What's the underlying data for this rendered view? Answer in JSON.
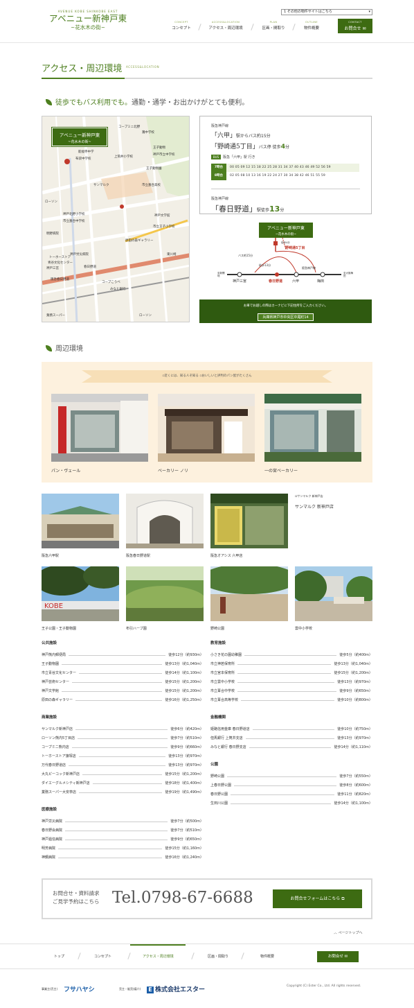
{
  "header": {
    "logo_en": "AVENUE KOBE SHINKOBE EAST",
    "logo_ja": "アベニュー新神戸東",
    "logo_sub": "~花水木の街~",
    "other_select": "1 その他の物件サイトはこちら",
    "nav": [
      {
        "en": "CONCEPT",
        "ja": "コンセプト"
      },
      {
        "en": "ACCESS&LOCATION",
        "ja": "アクセス・周辺環境"
      },
      {
        "en": "PLAN",
        "ja": "区画・間取り"
      },
      {
        "en": "OUTLINE",
        "ja": "物件概要"
      }
    ],
    "contact_en": "CONTACT",
    "contact_ja": "お問合せ"
  },
  "page": {
    "title_ja": "アクセス・周辺環境",
    "title_en": "ACCESS&LOCATION",
    "lead_green": "徒歩でもバス利用でも。",
    "lead_rest": "通勤・通学・お出かけがとても便利。"
  },
  "map": {
    "label": "アベニュー新神戸東",
    "label_sub": "~花水木の街~",
    "places": [
      "灘中学校",
      "能福寺中学",
      "布袋中学校",
      "上筒井小学校",
      "コープミニ北野",
      "王子動物",
      "神戸市立中学校",
      "王子動物園",
      "サンマルク",
      "市立葺合高校",
      "ローソン",
      "神戸北野小学校",
      "市立葺合中学校",
      "神戸三宮",
      "春日野道",
      "トーホーストア",
      "青谷文化センター",
      "みなと銀行",
      "コープこうべ",
      "東川崎",
      "原田の森ギャラリー",
      "神戸文学館",
      "市立王子小学校",
      "明野病院",
      "阪急春日野道",
      "ローソン",
      "業務スーパー",
      "神戸労災病院"
    ]
  },
  "bus": {
    "line1": "阪急神戸線",
    "station": "六甲",
    "station_suffix": "駅からバス約15分",
    "stop": "野崎通5丁目",
    "stop_suffix": "バス停 徒歩",
    "stop_min": "4",
    "stop_min_unit": "分",
    "bus_label": "阪急「六甲」駅 行き",
    "rows": [
      {
        "h": "7時台",
        "m": "00 05 09 12 15 18 22 25 28 31 34 37 40 43 46 49 52 56 59"
      },
      {
        "h": "8時台",
        "m": "02 05 08 10 13 16 19 22 24 27 30 34 38 42 46 51 55 59"
      }
    ],
    "line2": "阪急神戸線",
    "walk_station": "春日野道",
    "walk_prefix": "駅徒歩",
    "walk_min": "13",
    "walk_unit": "分"
  },
  "route": {
    "label": "アベニュー新神戸東",
    "label_sub": "~花水木の街~",
    "stop": "野崎通5丁目",
    "walk_bus": "徒歩4分",
    "bus_time": "バス約15分",
    "walk13": "徒歩13分",
    "line": "阪急神戸線",
    "stations": [
      "神戸三宮",
      "春日野道",
      "六甲",
      "梅田"
    ],
    "ends": [
      "至新開地",
      "至大阪梅田"
    ]
  },
  "car": {
    "text": "お車でお越しの際はカーナビに下記住所をご入力ください。",
    "address": "兵庫県神戸市中央区中尾町14"
  },
  "env": {
    "title": "周辺環境",
    "ribbon_a": "近くには、知る人ぞ知る",
    "ribbon_b": "おいしいと評判のパン屋がたくさん",
    "bakeries": [
      "パン・ヴェール",
      "ベーカリー ノリ",
      "一の宮ベーカリー"
    ],
    "photos": [
      "阪急六甲駅",
      "阪急春日野道駅",
      "阪急オアシス 六甲店",
      "サンマルク 新神戸店",
      "王子公園・王子動物園",
      "布引ハーブ園",
      "野崎公園",
      "雲中小学校"
    ],
    "sunmarc_alt": "サンマルク 新神戸店"
  },
  "facilities": {
    "left": [
      {
        "cat": "公共施設",
        "items": [
          {
            "n": "神戸熊内郵便局",
            "d": "徒歩12分（約930m）"
          },
          {
            "n": "王子動物園",
            "d": "徒歩13分（約1,040m）"
          },
          {
            "n": "市立青谷文化センター",
            "d": "徒歩14分（約1,100m）"
          },
          {
            "n": "神戸芸術センター",
            "d": "徒歩15分（約1,200m）"
          },
          {
            "n": "神戸文学館",
            "d": "徒歩15分（約1,200m）"
          },
          {
            "n": "原田の森ギャラリー",
            "d": "徒歩16分（約1,250m）"
          }
        ]
      },
      {
        "cat": "商業施設",
        "items": [
          {
            "n": "サンマルク新神戸店",
            "d": "徒歩6分（約420m）"
          },
          {
            "n": "ローソン熊内5丁目店",
            "d": "徒歩7分（約510m）"
          },
          {
            "n": "コープミニ熊内店",
            "d": "徒歩9分（約660m）"
          },
          {
            "n": "トーホーストア旗塚店",
            "d": "徒歩13分（約970m）"
          },
          {
            "n": "万代春日野道店",
            "d": "徒歩13分（約970m）"
          },
          {
            "n": "大丸ピーコック新神戸店",
            "d": "徒歩15分（約1,200m）"
          },
          {
            "n": "ダイエーグルメシティ新神戸店",
            "d": "徒歩18分（約1,400m）"
          },
          {
            "n": "業務スーパー大安亭店",
            "d": "徒歩19分（約1,490m）"
          }
        ]
      },
      {
        "cat": "医療施設",
        "items": [
          {
            "n": "神戸労災病院",
            "d": "徒歩7分（約500m）"
          },
          {
            "n": "春日野会病院",
            "d": "徒歩7分（約510m）"
          },
          {
            "n": "神戸逓信病院",
            "d": "徒歩9分（約650m）"
          },
          {
            "n": "明芳病院",
            "d": "徒歩15分（約1,160m）"
          },
          {
            "n": "神鋼病院",
            "d": "徒歩16分（約1,240m）"
          }
        ]
      }
    ],
    "right": [
      {
        "cat": "教育施設",
        "items": [
          {
            "n": "小さき花の園幼稚園",
            "d": "徒歩5分（約400m）"
          },
          {
            "n": "市立神若保育所",
            "d": "徒歩13分（約1,040m）"
          },
          {
            "n": "市立宮本保育所",
            "d": "徒歩15分（約1,200m）"
          },
          {
            "n": "市立雲中小学校",
            "d": "徒歩13分（約970m）"
          },
          {
            "n": "市立葺合中学校",
            "d": "徒歩9分（約650m）"
          },
          {
            "n": "市立葺合高等学校",
            "d": "徒歩10分（約800m）"
          }
        ]
      },
      {
        "cat": "金融機関",
        "items": [
          {
            "n": "姫路信用金庫 春日野道店",
            "d": "徒歩10分（約750m）"
          },
          {
            "n": "但馬銀行 上筒井支店",
            "d": "徒歩13分（約970m）"
          },
          {
            "n": "みなと銀行 春日野支店",
            "d": "徒歩14分（約1,110m）"
          }
        ]
      },
      {
        "cat": "公園",
        "items": [
          {
            "n": "野崎公園",
            "d": "徒歩7分（約550m）"
          },
          {
            "n": "上春日野公園",
            "d": "徒歩8分（約600m）"
          },
          {
            "n": "春日野公園",
            "d": "徒歩11分（約820m）"
          },
          {
            "n": "生田川公園",
            "d": "徒歩14分（約1,100m）"
          }
        ]
      }
    ]
  },
  "contact": {
    "line1": "お問合せ・資料請求",
    "line2": "ご見学予約はこちら",
    "tel": "Tel.0798-67-6688",
    "button": "お問合せフォームはこちら"
  },
  "pagetop": "ページトップへ",
  "footer_nav": [
    "トップ",
    "コンセプト",
    "アクセス・周辺環境",
    "区画・間取り",
    "物件概要"
  ],
  "footer_contact": "お問合せ",
  "footer": {
    "label1": "事業主(売主)",
    "company1": "フサハヤシ",
    "label2": "売主・販売(媒介)",
    "company2": "株式会社エスター",
    "copyright": "Copyright (C) Ester Co., Ltd. All rights reserved."
  },
  "colors": {
    "accent": "#4d7f1f",
    "dark": "#3d6b12",
    "bakery_bg": "#fdf1de"
  }
}
